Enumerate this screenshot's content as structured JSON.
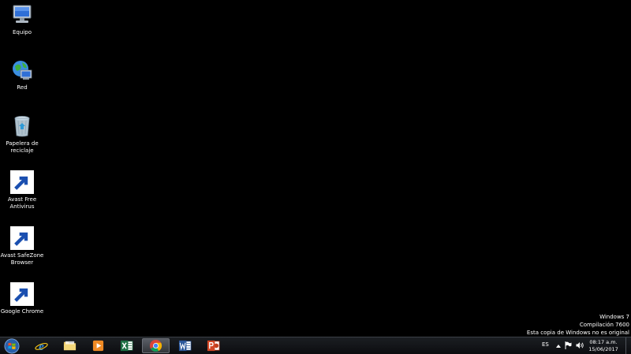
{
  "desktop": {
    "icons": [
      {
        "label": "Equipo",
        "icon": "computer-icon"
      },
      {
        "label": "Red",
        "icon": "network-icon"
      },
      {
        "label": "Papelera de\nreciclaje",
        "icon": "recycle-bin-icon"
      },
      {
        "label": "Avast Free\nAntivirus",
        "icon": "avast-icon"
      },
      {
        "label": "Avast SafeZone\nBrowser",
        "icon": "avast-safezone-icon"
      },
      {
        "label": "Google Chrome",
        "icon": "chrome-icon"
      }
    ]
  },
  "watermark": {
    "line1": "Windows 7",
    "line2": "Compilación 7600",
    "line3": "Esta copia de Windows no es original"
  },
  "taskbar": {
    "pinned": [
      {
        "icon": "internet-explorer-icon",
        "active": false
      },
      {
        "icon": "file-explorer-icon",
        "active": false
      },
      {
        "icon": "media-player-icon",
        "active": false
      },
      {
        "icon": "excel-icon",
        "active": false
      },
      {
        "icon": "chrome-icon",
        "active": true
      },
      {
        "icon": "word-icon",
        "active": false
      },
      {
        "icon": "powerpoint-icon",
        "active": false
      }
    ]
  },
  "tray": {
    "language": "ES",
    "time": "08:17 a.m.",
    "date": "15/06/2017"
  },
  "colors": {
    "desktop_bg": "#000000",
    "taskbar_bg": "#14161a",
    "text": "#ffffff"
  }
}
